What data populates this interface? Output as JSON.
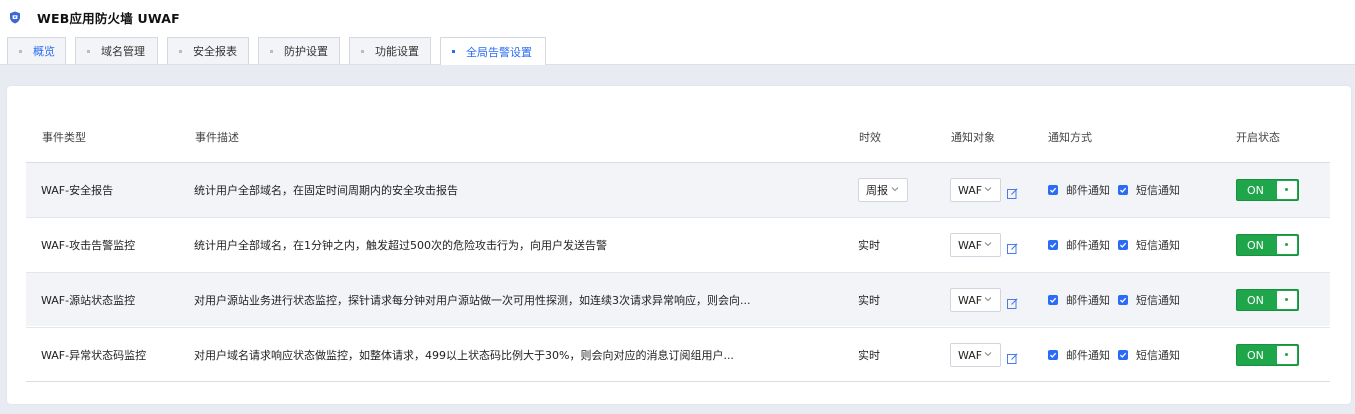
{
  "app": {
    "title": "WEB应用防火墙 UWAF",
    "logo_icon": "shield-icon",
    "accent": "#2a6cf6"
  },
  "tabs": [
    {
      "label": "概览",
      "active": false
    },
    {
      "label": "域名管理",
      "active": false
    },
    {
      "label": "安全报表",
      "active": false
    },
    {
      "label": "防护设置",
      "active": false
    },
    {
      "label": "功能设置",
      "active": false
    },
    {
      "label": "全局告警设置",
      "active": true
    }
  ],
  "table": {
    "columns": [
      "事件类型",
      "事件描述",
      "时效",
      "通知对象",
      "通知方式",
      "开启状态"
    ],
    "rows": [
      {
        "type": "WAF-安全报告",
        "desc": "统计用户全部域名，在固定时间周期内的安全攻击报告",
        "timing": "周报",
        "timing_is_select": true,
        "target": "WAF",
        "email_label": "邮件通知",
        "email_checked": true,
        "sms_label": "短信通知",
        "sms_checked": true,
        "status": "ON"
      },
      {
        "type": "WAF-攻击告警监控",
        "desc": "统计用户全部域名，在1分钟之内，触发超过500次的危险攻击行为，向用户发送告警",
        "timing": "实时",
        "timing_is_select": false,
        "target": "WAF",
        "email_label": "邮件通知",
        "email_checked": true,
        "sms_label": "短信通知",
        "sms_checked": true,
        "status": "ON"
      },
      {
        "type": "WAF-源站状态监控",
        "desc": "对用户源站业务进行状态监控，探针请求每分钟对用户源站做一次可用性探测，如连续3次请求异常响应，则会向...",
        "timing": "实时",
        "timing_is_select": false,
        "target": "WAF",
        "email_label": "邮件通知",
        "email_checked": true,
        "sms_label": "短信通知",
        "sms_checked": true,
        "status": "ON"
      },
      {
        "type": "WAF-异常状态码监控",
        "desc": "对用户域名请求响应状态做监控，如整体请求，499以上状态码比例大于30%，则会向对应的消息订阅组用户...",
        "timing": "实时",
        "timing_is_select": false,
        "target": "WAF",
        "email_label": "邮件通知",
        "email_checked": true,
        "sms_label": "短信通知",
        "sms_checked": true,
        "status": "ON"
      }
    ]
  },
  "colors": {
    "toggle_on": "#1fa54a",
    "checkbox": "#2a6cf6",
    "row_alt": "#f3f4f8"
  }
}
